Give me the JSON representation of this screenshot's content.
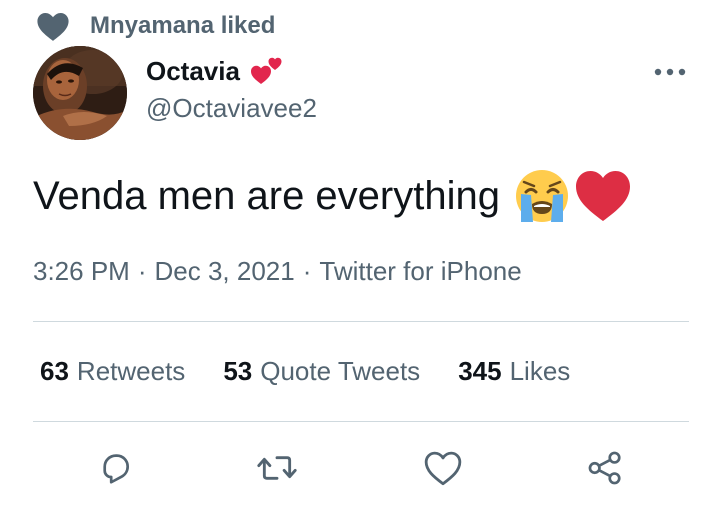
{
  "context": {
    "text": "Mnyamana liked",
    "icon": "heart-icon"
  },
  "author": {
    "display_name": "Octavia",
    "name_emoji": "two-hearts-emoji",
    "username": "@Octaviavee2"
  },
  "tweet": {
    "text": "Venda men are everything",
    "emojis": [
      "loudly-crying-face-emoji",
      "red-heart-emoji"
    ]
  },
  "meta": {
    "time": "3:26 PM",
    "date": "Dec 3, 2021",
    "source": "Twitter for iPhone",
    "separator": "·"
  },
  "stats": {
    "retweets": {
      "count": "63",
      "label": "Retweets"
    },
    "quotes": {
      "count": "53",
      "label": "Quote Tweets"
    },
    "likes": {
      "count": "345",
      "label": "Likes"
    }
  },
  "actions": [
    "reply-icon",
    "retweet-icon",
    "like-icon",
    "share-icon"
  ],
  "colors": {
    "text_primary": "#0f1419",
    "text_secondary": "#536471",
    "divider": "#cfd9de",
    "heart_red": "#e2264d"
  }
}
